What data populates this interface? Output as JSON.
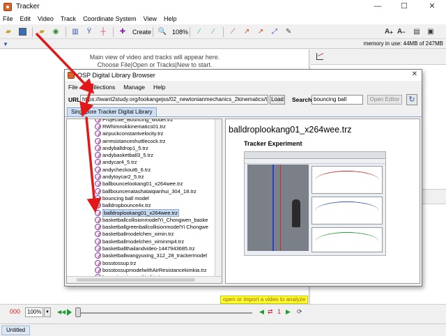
{
  "window": {
    "title": "Tracker",
    "minimize": "—",
    "maximize": "☐",
    "close": "✕"
  },
  "menu": [
    "File",
    "Edit",
    "Video",
    "Track",
    "Coordinate System",
    "View",
    "Help"
  ],
  "toolbar": {
    "create_label": "Create",
    "zoom_label": "108%"
  },
  "memory_text": "memory in use: 44MB of 247MB",
  "main_message": {
    "line1": "Main view of video and tracks will appear here.",
    "line2": "Choose File|Open or Tracks|New to start."
  },
  "player": {
    "frame": "000",
    "zoom": "100%",
    "step_count": "1"
  },
  "hint_text": "open or import a video to analyze",
  "status_tab": "Untitled",
  "library": {
    "title": "OSP Digital Library Browser",
    "menu": [
      "File",
      "Collections",
      "Manage",
      "Help"
    ],
    "url_label": "URL:",
    "url_value": "https://iwant2study.org/lookangejss/02_newtonianmechanics_2kinematics/trz/",
    "load_label": "Load",
    "search_label": "Search",
    "search_value": "bouncing ball",
    "open_editor_label": "Open Editor",
    "tab_label": "Singapore Tracker Digital Library",
    "items": [
      "Projectile_Bouncing_Model.trz",
      "RWhimnokkinematics01.trz",
      "airpuckconstantvelocity.trz",
      "airresistanceshuttlecock.trz",
      "andyballdrop1_5.trz",
      "andybasketball3_5.trz",
      "andycar4_5.trz",
      "andycheckout6_6.trz",
      "andytoycar2_5.trz",
      "ballbouncelookang01_x264wee.trz",
      "ballbouncenatashataiqianhui_304_18.trz",
      "bouncing ball model",
      "balldropbounce4x.trz",
      "balldroplookang01_x264wee.trz",
      "basketballcollisionmodelYi_Chongwen_baske",
      "basketballgreenballcollisionmodelYi Chongwe",
      "basketballmodelchen_ximin.trz",
      "basketballmodelchen_ximinmp4.trz",
      "basketballthailandvideo-1447943685.trz",
      "basketballwangyuxing_312_28_trackermodel",
      "bosstossup.trz",
      "bosstossupmodelwithAirResistancekimkia.trz",
      "bouncingpinpongkimkia.trz"
    ],
    "selected_index": 13,
    "preview_title": "balldroplookang01_x264wee.trz",
    "preview_subtitle": "Tracker Experiment"
  },
  "colors": {
    "annotation_arrow": "#e21818",
    "frame_number": "#d42020",
    "hint_bg": "#ffff33"
  }
}
